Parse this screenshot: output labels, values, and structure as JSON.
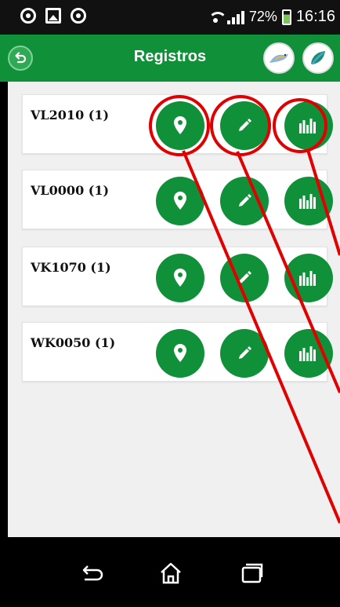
{
  "status_bar": {
    "battery_percent": "72%",
    "time": "16:16"
  },
  "header": {
    "title": "Registros"
  },
  "records": [
    {
      "label": "VL2010 (1)"
    },
    {
      "label": "VL0000 (1)"
    },
    {
      "label": "VK1070 (1)"
    },
    {
      "label": "WK0050 (1)"
    }
  ],
  "colors": {
    "primary_green": "#11903a",
    "annotation_red": "#e00000",
    "background": "#f0f0f0"
  },
  "icons": {
    "record_actions": [
      "map-pin-icon",
      "edit-pencil-icon",
      "bar-chart-icon"
    ],
    "header_actions": [
      "bird-icon",
      "leaf-icon"
    ],
    "nav": [
      "back-icon",
      "home-icon",
      "recent-apps-icon"
    ]
  }
}
